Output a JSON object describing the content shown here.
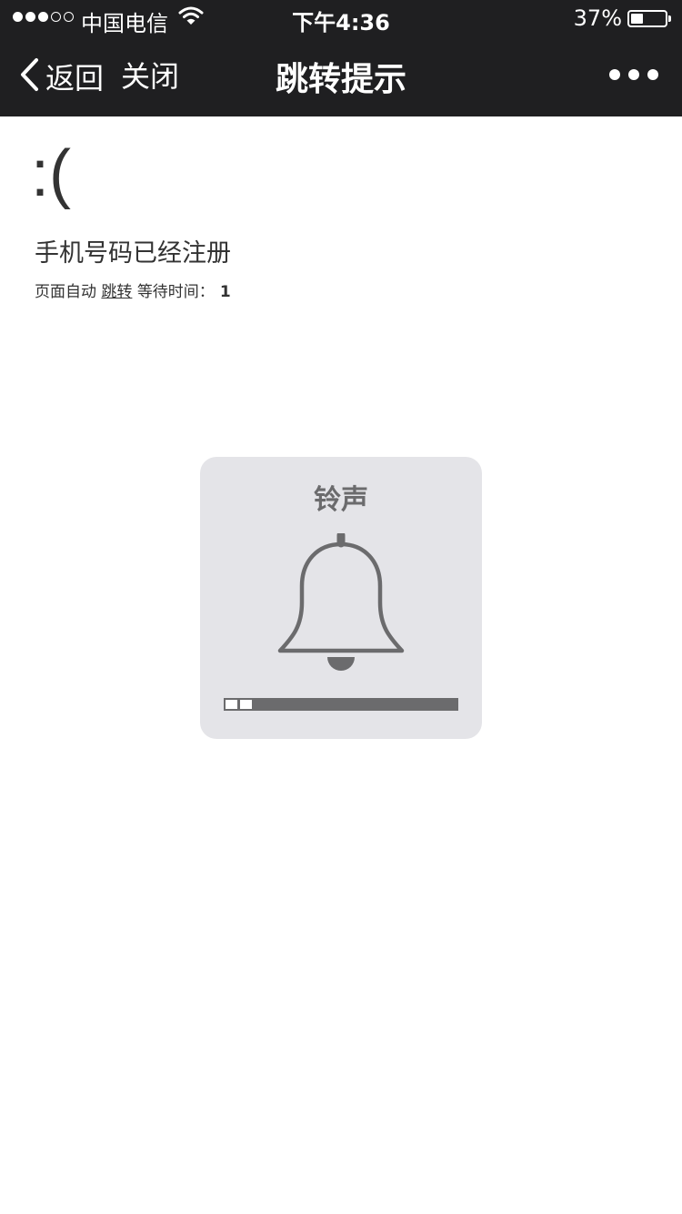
{
  "status_bar": {
    "carrier": "中国电信",
    "time": "下午4:36",
    "battery": "37%",
    "battery_level": 0.37,
    "signal_strength": 3,
    "signal_max": 5
  },
  "nav": {
    "back_label": "返回",
    "close_label": "关闭",
    "title": "跳转提示"
  },
  "content": {
    "sad_face": ":(",
    "message": "手机号码已经注册",
    "auto_prefix": "页面自动",
    "redirect_link": "跳转",
    "wait_label": "等待时间：",
    "wait_seconds": "1"
  },
  "volume_hud": {
    "title": "铃声",
    "level": 2,
    "max_level": 16
  },
  "colors": {
    "bar_background": "#1f1f21",
    "hud_background": "#e4e4e8",
    "hud_foreground": "#6b6b6d"
  }
}
